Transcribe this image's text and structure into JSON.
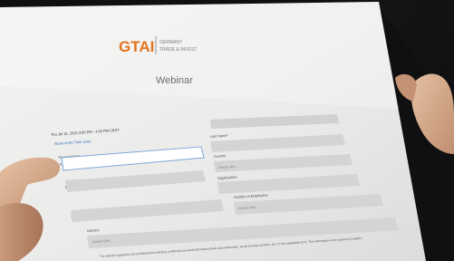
{
  "brand": {
    "logo_text": "GTAI",
    "tagline_line1": "GERMANY",
    "tagline_line2": "TRADE & INVEST",
    "accent_color": "#e2721b",
    "brand_gray": "#7c7e82"
  },
  "page": {
    "title": "Webinar"
  },
  "event": {
    "datetime": "Thu Jul 14, 2016 3:00 PM - 4:00 PM CEST",
    "calendar_link": "Show in My Time Zone"
  },
  "form": {
    "required_note": "*Required field",
    "fields": {
      "first_name": {
        "label": "First Name*",
        "value": ""
      },
      "last_name": {
        "label": "Last Name*",
        "value": ""
      },
      "country": {
        "label": "Country",
        "placeholder": "Choose one..."
      },
      "email": {
        "label": "Email Address*",
        "value": ""
      },
      "organization": {
        "label": "Organization",
        "value": ""
      },
      "job_title": {
        "label": "Job Title",
        "value": ""
      },
      "employees": {
        "label": "Number of Employees",
        "placeholder": "Choose One..."
      },
      "industry": {
        "label": "Industry",
        "placeholder": "Choose One..."
      }
    },
    "disclaimer": "The webinar organizers are prohibited from soliciting confidential personal information (bank card information, social security numbers, etc.) in the registration form. This information is not required to register."
  }
}
